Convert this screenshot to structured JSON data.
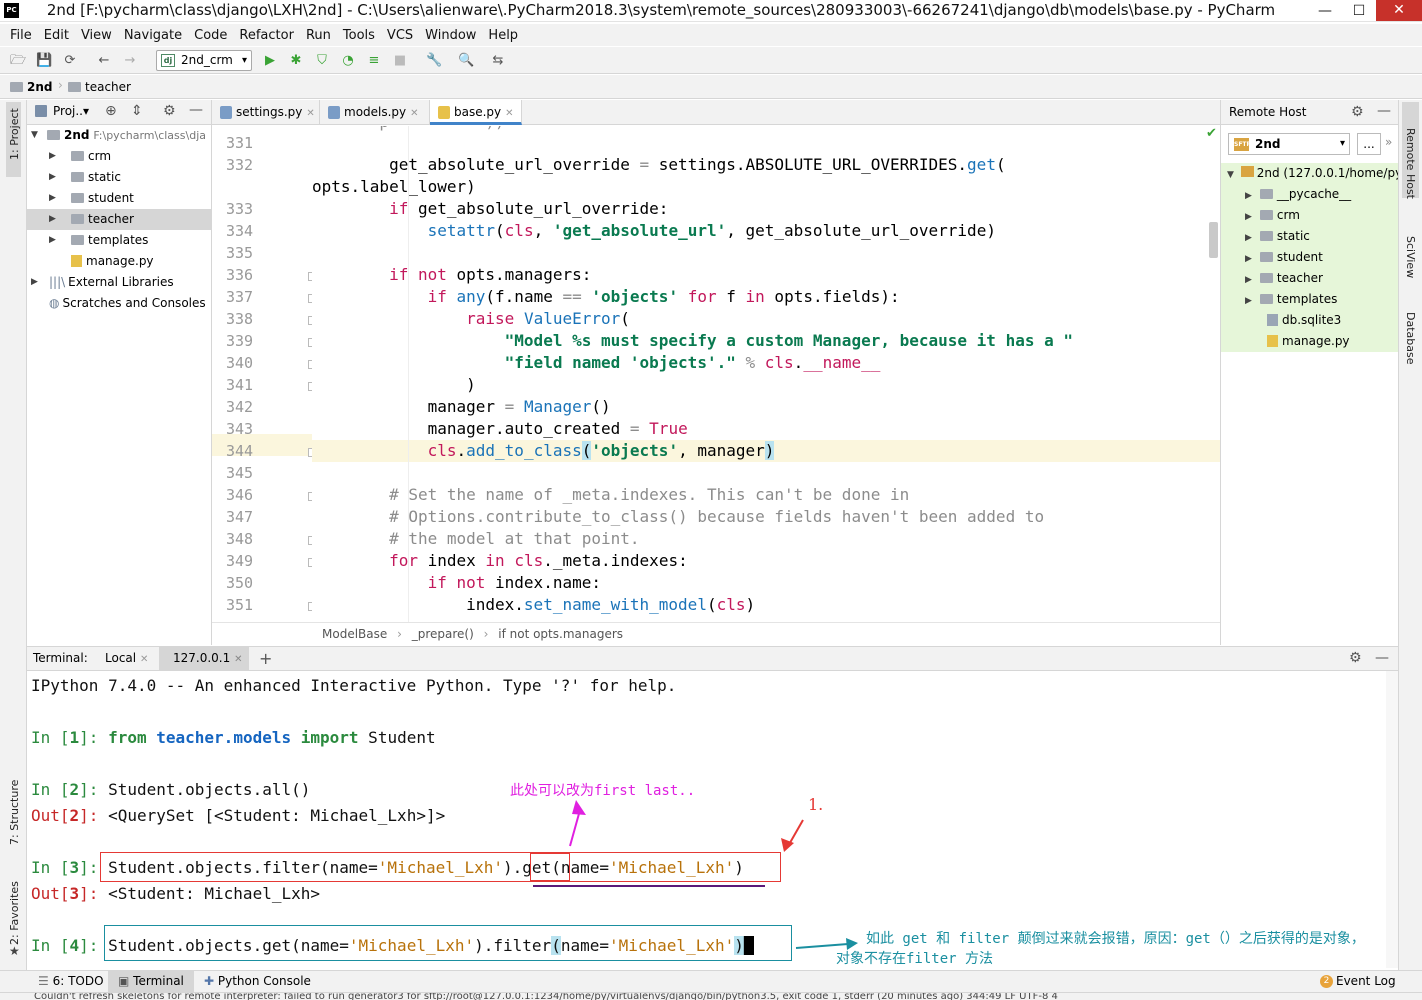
{
  "window": {
    "title": "2nd [F:\\pycharm\\class\\django\\LXH\\2nd] - C:\\Users\\alienware\\.PyCharm2018.3\\system\\remote_sources\\280933003\\-66267241\\django\\db\\models\\base.py - PyCharm",
    "logo": "PC",
    "minimize": "—",
    "maximize": "☐",
    "close": "✕"
  },
  "menu": [
    "File",
    "Edit",
    "View",
    "Navigate",
    "Code",
    "Refactor",
    "Run",
    "Tools",
    "VCS",
    "Window",
    "Help"
  ],
  "toolbar": {
    "run_config": "2nd_crm",
    "run_config_badge": "dj"
  },
  "breadcrumb": {
    "root": "2nd",
    "child": "teacher"
  },
  "left_stripe": {
    "project_tab": "1: Project",
    "structure_tab": "7: Structure",
    "favorites_tab": "2: Favorites"
  },
  "project_panel": {
    "header": "Proj..▾",
    "root": {
      "name": "2nd",
      "path": "F:\\pycharm\\class\\dja"
    },
    "items": [
      {
        "label": "crm"
      },
      {
        "label": "static"
      },
      {
        "label": "student"
      },
      {
        "label": "teacher"
      },
      {
        "label": "templates"
      },
      {
        "label": "manage.py"
      },
      {
        "label": "External Libraries"
      },
      {
        "label": "Scratches and Consoles"
      }
    ]
  },
  "editor": {
    "tabs": [
      {
        "label": "settings.py",
        "icon_color": "#7a9cc6"
      },
      {
        "label": "models.py",
        "icon_color": "#7a9cc6"
      },
      {
        "label": "base.py",
        "icon_color": "#e7c14a"
      }
    ],
    "line_numbers": [
      "331",
      "332",
      "333",
      "334",
      "335",
      "336",
      "337",
      "338",
      "339",
      "340",
      "341",
      "342",
      "343",
      "344",
      "345",
      "346",
      "347",
      "348",
      "349",
      "350",
      "351"
    ],
    "breadcrumbs": [
      "ModelBase",
      "_prepare()",
      "if not opts.managers"
    ]
  },
  "remote_panel": {
    "title": "Remote Host",
    "server_select": "2nd",
    "browse_btn": "...",
    "root": "2nd (127.0.0.1/home/py",
    "items": [
      {
        "label": "__pycache__"
      },
      {
        "label": "crm"
      },
      {
        "label": "static"
      },
      {
        "label": "student"
      },
      {
        "label": "teacher"
      },
      {
        "label": "templates"
      },
      {
        "label": "db.sqlite3"
      },
      {
        "label": "manage.py"
      }
    ]
  },
  "right_stripe": {
    "remote_host_tab": "Remote Host",
    "sciview_tab": "SciView",
    "database_tab": "Database"
  },
  "terminal": {
    "label": "Terminal:",
    "tabs": [
      {
        "label": "Local"
      },
      {
        "label": "127.0.0.1"
      }
    ],
    "add": "+",
    "banner": "IPython 7.4.0 -- An enhanced Interactive Python. Type '?' for help."
  },
  "annotations": {
    "note_first": "此处可以改为first  last..",
    "note_num": "1.",
    "note_swap_1": "如此 get 和 filter 颠倒过来就会报错，原因：get（）之后获得的是对象，",
    "note_swap_2": "对象不存在filter 方法",
    "note_color_pink": "#e020e0",
    "note_color_red": "#e53935",
    "note_color_teal": "#1a8fa0"
  },
  "bottom_tabs": [
    {
      "label": "6: TODO"
    },
    {
      "label": "Terminal"
    },
    {
      "label": "Python Console"
    }
  ],
  "event_log": {
    "count": "2",
    "label": "Event Log"
  },
  "status_text": "Couldn't refresh skeletons for remote interpreter: failed to run generator3 for sftp://root@127.0.0.1:1234/home/py/virtualenvs/django/bin/python3.5, exit code 1, stderr (20 minutes ago)    344:49  LF  UTF-8  4"
}
